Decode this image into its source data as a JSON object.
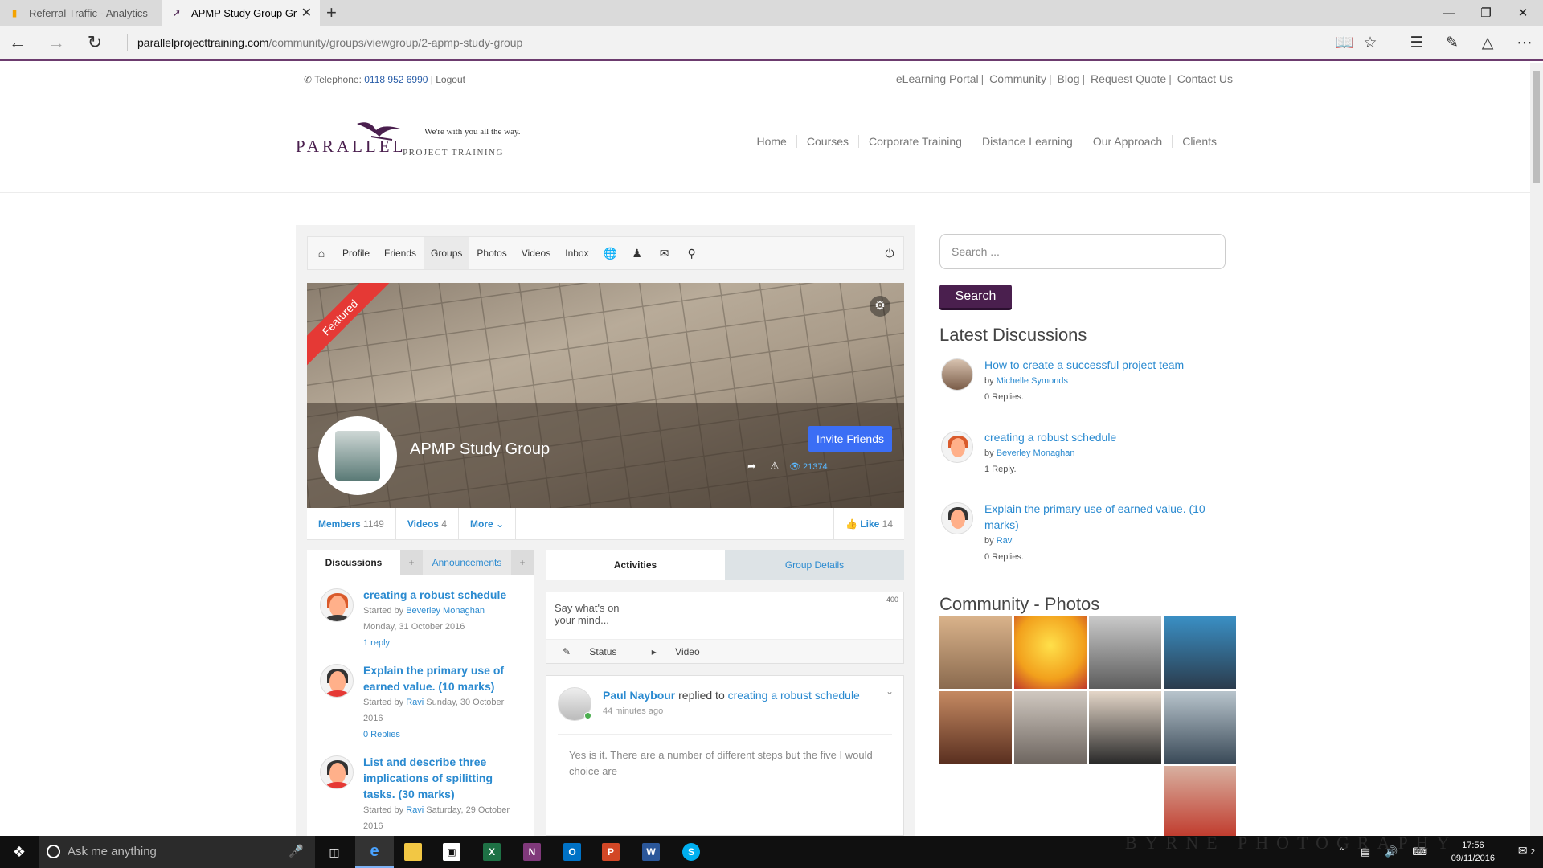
{
  "browser": {
    "tabs": [
      {
        "label": "Referral Traffic - Analytics",
        "icon": "analytics-icon"
      },
      {
        "label": "APMP Study Group Gro",
        "icon": "bird-logo-icon"
      }
    ],
    "url_host": "parallelprojecttraining.com",
    "url_path": "/community/groups/viewgroup/2-apmp-study-group",
    "accent": "#6c3b6e"
  },
  "site": {
    "telephone_label": "Telephone:",
    "telephone_number": "0118 952 6990",
    "logout": "Logout",
    "top_links": [
      "eLearning Portal",
      "Community",
      "Blog",
      "Request Quote",
      "Contact Us"
    ],
    "brand": "PARALLEL",
    "brand_sub": "PROJECT TRAINING",
    "tagline": "We're with you all the way.",
    "nav": [
      "Home",
      "Courses",
      "Corporate Training",
      "Distance Learning",
      "Our Approach",
      "Clients"
    ]
  },
  "community": {
    "toolbar": [
      "Profile",
      "Friends",
      "Groups",
      "Photos",
      "Videos",
      "Inbox"
    ],
    "featured": "Featured",
    "group_title": "APMP Study Group",
    "invite": "Invite Friends",
    "views": "21374",
    "stats": {
      "members_label": "Members",
      "members": "1149",
      "videos_label": "Videos",
      "videos": "4",
      "more": "More",
      "like_label": "Like",
      "likes": "14"
    },
    "left_tabs": {
      "discussions": "Discussions",
      "announcements": "Announcements",
      "plus": "+"
    },
    "discussions": [
      {
        "title": "creating a robust schedule",
        "started_by": "Started by",
        "author": "Beverley Monaghan",
        "date": "Monday, 31 October 2016",
        "replies": "1 reply"
      },
      {
        "title": "Explain the primary use of earned value. (10 marks)",
        "started_by": "Started by",
        "author": "Ravi",
        "date": "Sunday, 30 October 2016",
        "replies": "0 Replies"
      },
      {
        "title": "List and describe three implications of spilitting tasks. (30 marks)",
        "started_by": "Started by",
        "author": "Ravi",
        "date": "Saturday, 29 October 2016",
        "replies": ""
      }
    ],
    "right_tabs": {
      "activities": "Activities",
      "details": "Group Details"
    },
    "composer": {
      "placeholder": "Say what's on your mind...",
      "count": "400",
      "status": "Status",
      "video": "Video"
    },
    "activity": {
      "user": "Paul Naybour",
      "action": "replied to",
      "link": "creating a robust schedule",
      "time": "44 minutes ago",
      "body": "Yes is it. There are a number of different steps but the five I would choice are"
    }
  },
  "sidebar": {
    "search_placeholder": "Search ...",
    "search_button": "Search",
    "latest_heading": "Latest Discussions",
    "latest": [
      {
        "title": "How to create a successful project team",
        "by": "by",
        "author": "Michelle Symonds",
        "replies": "0 Replies."
      },
      {
        "title": "creating a robust schedule",
        "by": "by",
        "author": "Beverley Monaghan",
        "replies": "1 Reply."
      },
      {
        "title": "Explain the primary use of earned value. (10 marks)",
        "by": "by",
        "author": "Ravi",
        "replies": "0 Replies."
      }
    ],
    "photos_heading": "Community - Photos",
    "search_button_color": "#4a1f4e"
  },
  "taskbar": {
    "search": "Ask me anything",
    "time": "17:56",
    "date": "09/11/2016",
    "notifications": "2",
    "watermark": "BYRNE PHOTOGRAPHY"
  }
}
